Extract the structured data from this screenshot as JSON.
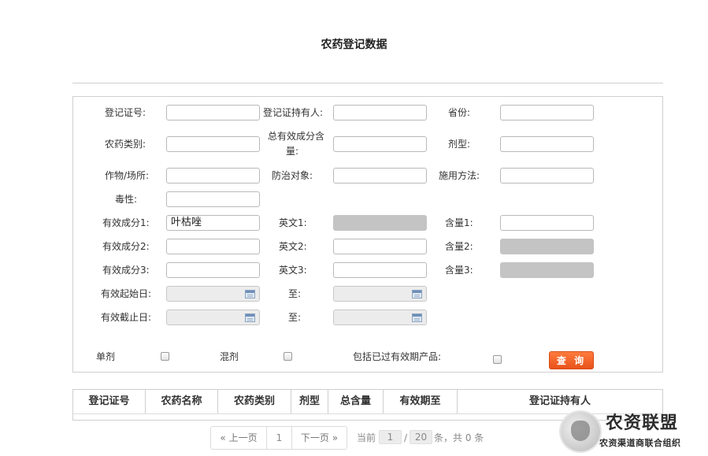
{
  "page": {
    "title": "农药登记数据"
  },
  "form": {
    "row1": {
      "reg_no_label": "登记证号:",
      "holder_label": "登记证持有人:",
      "province_label": "省份:"
    },
    "row2": {
      "category_label": "农药类别:",
      "total_content_label_line1": "总有效成分含",
      "total_content_label_line2": "量:",
      "formulation_label": "剂型:"
    },
    "row3": {
      "crop_label": "作物/场所:",
      "target_label": "防治对象:",
      "method_label": "施用方法:"
    },
    "row4": {
      "toxicity_label": "毒性:"
    },
    "ingredients": [
      {
        "name_label": "有效成分1:",
        "name_value": "叶枯唑",
        "en_label": "英文1:",
        "content_label": "含量1:"
      },
      {
        "name_label": "有效成分2:",
        "name_value": "",
        "en_label": "英文2:",
        "content_label": "含量2:"
      },
      {
        "name_label": "有效成分3:",
        "name_value": "",
        "en_label": "英文3:",
        "content_label": "含量3:"
      }
    ],
    "dates": {
      "start_label": "有效起始日:",
      "end_label": "有效截止日:",
      "to_label": "至:"
    },
    "options": {
      "single_label": "单剂",
      "mixed_label": "混剂",
      "include_expired_label": "包括已过有效期产品:"
    },
    "query_button": "查 询"
  },
  "table": {
    "columns": [
      "登记证号",
      "农药名称",
      "农药类别",
      "剂型",
      "总含量",
      "有效期至",
      "登记证持有人"
    ]
  },
  "pagination": {
    "prev": "« 上一页",
    "current_page": "1",
    "next": "下一页 »",
    "current_label": "当前",
    "page_box": "1",
    "slash": "/",
    "total_pages": "20",
    "total_suffix": "条，共 0 条"
  },
  "logo": {
    "main": "农资联盟",
    "sub": "农资渠道商联合组织",
    "icon": "lion-head-icon"
  }
}
